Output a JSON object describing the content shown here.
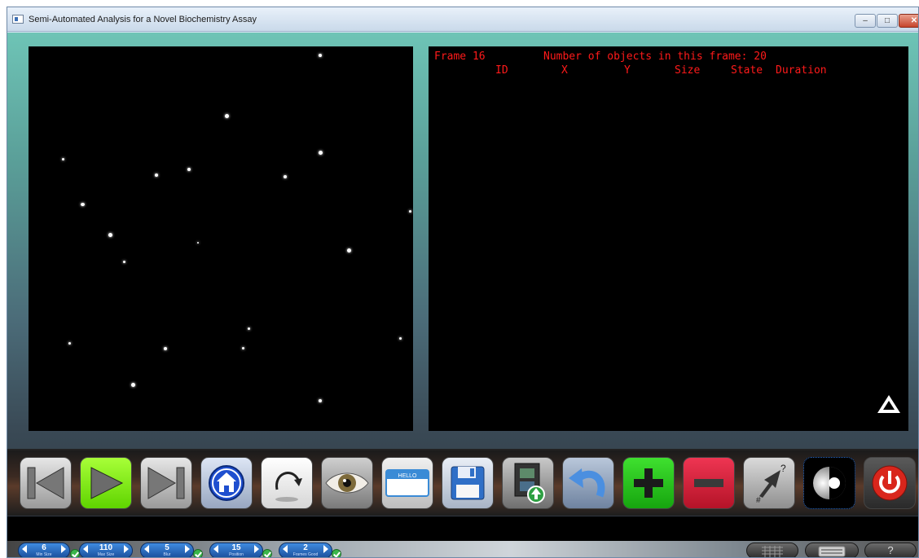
{
  "window": {
    "title": "Semi-Automated Analysis for a Novel Biochemistry Assay",
    "minimize_label": "–",
    "maximize_label": "□",
    "close_label": "✕"
  },
  "info_panel": {
    "frame_label": "Frame 16",
    "objects_label": "Number of objects in this frame: 20",
    "columns": [
      "ID",
      "X",
      "Y",
      "Size",
      "State",
      "Duration"
    ]
  },
  "toolbar": {
    "buttons": [
      {
        "name": "previous-frame-button",
        "icon": "skip-back-icon"
      },
      {
        "name": "play-button",
        "icon": "play-icon"
      },
      {
        "name": "next-frame-button",
        "icon": "skip-forward-icon"
      },
      {
        "name": "home-button",
        "icon": "home-icon"
      },
      {
        "name": "rotate-button",
        "icon": "rotate-arrow-icon"
      },
      {
        "name": "view-button",
        "icon": "eye-icon"
      },
      {
        "name": "label-button",
        "icon": "name-tag-icon"
      },
      {
        "name": "save-button",
        "icon": "floppy-disk-icon"
      },
      {
        "name": "export-video-button",
        "icon": "film-upload-icon"
      },
      {
        "name": "undo-button",
        "icon": "undo-arrow-icon"
      },
      {
        "name": "add-button",
        "icon": "plus-icon"
      },
      {
        "name": "remove-button",
        "icon": "minus-icon"
      },
      {
        "name": "pointer-help-button",
        "icon": "pointer-question-icon"
      },
      {
        "name": "contrast-button",
        "icon": "contrast-icon"
      },
      {
        "name": "power-button",
        "icon": "power-icon"
      }
    ],
    "name_tag_text": "HELLO"
  },
  "status_controls": {
    "spinners": [
      {
        "value": "6",
        "label": "Min Size"
      },
      {
        "value": "110",
        "label": "Max Size"
      },
      {
        "value": "5",
        "label": "Blur"
      },
      {
        "value": "15",
        "label": "Position"
      },
      {
        "value": "2",
        "label": "Frames Good"
      }
    ],
    "right_buttons": [
      {
        "name": "grid-button",
        "icon": "grid-icon",
        "label": ""
      },
      {
        "name": "keyboard-button",
        "icon": "keyboard-icon",
        "label": ""
      },
      {
        "name": "help-button",
        "icon": "help-icon",
        "label": "?"
      }
    ]
  },
  "colors": {
    "overlay_text": "#ff1a1a",
    "play_active": "#7cf200",
    "add_green": "#22c81d",
    "remove_red": "#d81f3c",
    "spinner_blue": "#2a6bc8"
  }
}
